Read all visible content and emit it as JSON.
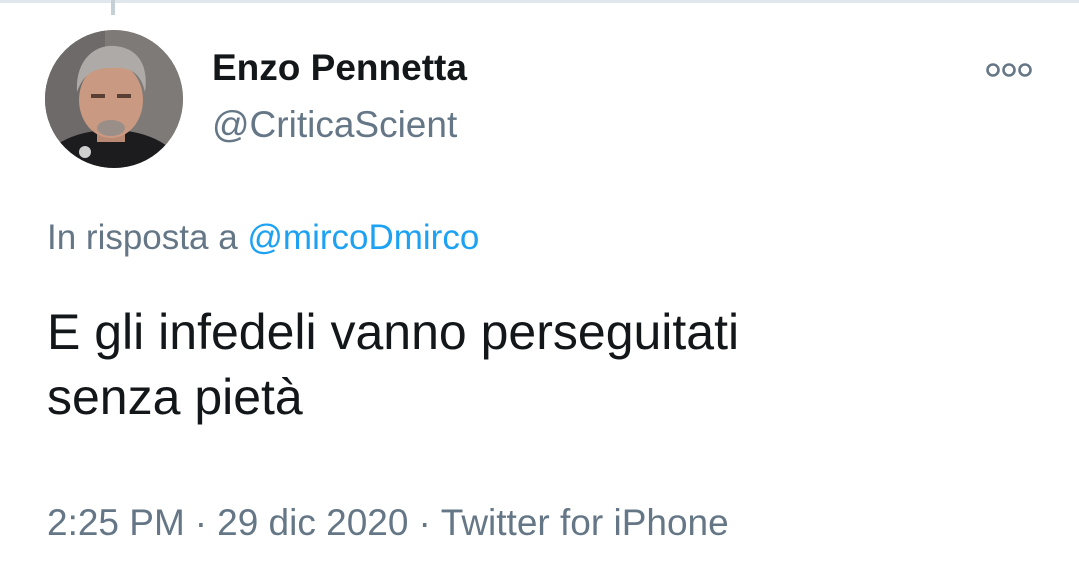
{
  "colors": {
    "text_primary": "#14171a",
    "text_secondary": "#657786",
    "link": "#1da1f2",
    "divider": "#e1e8ed"
  },
  "user": {
    "display_name": "Enzo Pennetta",
    "handle": "@CriticaScient",
    "avatar_icon": "user-photo"
  },
  "more_icon": "more-options-icon",
  "reply": {
    "prefix": "In risposta a",
    "mention": "@mircoDmirco"
  },
  "tweet": {
    "line1": "E gli infedeli vanno perseguitati",
    "line2": "senza pietà"
  },
  "meta": {
    "time": "2:25 PM",
    "separator": "·",
    "date": "29 dic 2020",
    "source": "Twitter for iPhone"
  }
}
